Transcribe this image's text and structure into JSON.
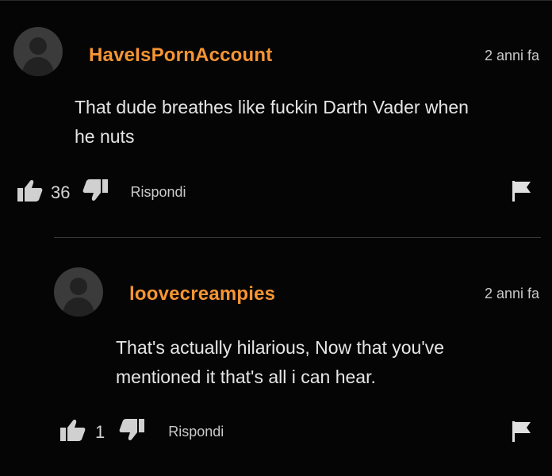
{
  "comments": [
    {
      "username": "HaveIsPornAccount",
      "time": "2 anni fa",
      "text_lines": [
        "That dude breathes like fuckin Darth Vader when",
        "he nuts"
      ],
      "likes": "36",
      "reply_label": "Rispondi",
      "avatar_icon": "user-silhouette-icon"
    },
    {
      "username": "loovecreampies",
      "time": "2 anni fa",
      "text_lines": [
        "That's actually hilarious, Now that you've",
        "mentioned it that's all i can hear."
      ],
      "likes": "1",
      "reply_label": "Rispondi",
      "avatar_icon": "user-silhouette-icon"
    }
  ],
  "colors": {
    "background": "#050505",
    "username": "#f79533",
    "text": "#e6e6e6",
    "meta": "#c9c9c9"
  }
}
